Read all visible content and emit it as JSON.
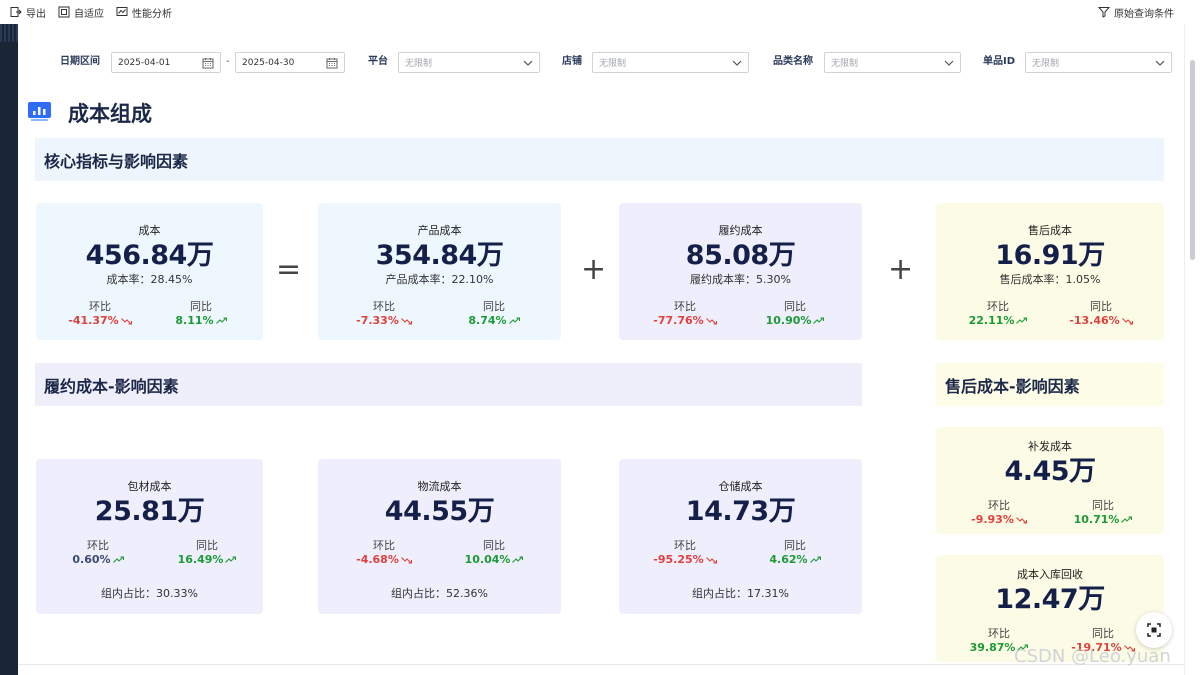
{
  "toolbar": {
    "export_label": "导出",
    "fit_label": "自适应",
    "perf_label": "性能分析",
    "query_label": "原始查询条件"
  },
  "filters": {
    "date_label": "日期区间",
    "date_start": "2025-04-01",
    "date_sep": "-",
    "date_end": "2025-04-30",
    "platform_label": "平台",
    "store_label": "店铺",
    "category_label": "品类名称",
    "item_label": "单品ID",
    "unlimited": "无限制"
  },
  "page_title": "成本组成",
  "sections": {
    "core": "核心指标与影响因素",
    "fulfill": "履约成本-影响因素",
    "aftersale": "售后成本-影响因素"
  },
  "operators": {
    "equals": "=",
    "plus": "+"
  },
  "core_cards": [
    {
      "label": "成本",
      "value": "456.84万",
      "rate": "成本率：28.45%",
      "mom_label": "环比",
      "mom": "-41.37%",
      "mom_dir": "down",
      "yoy_label": "同比",
      "yoy": "8.11%",
      "yoy_dir": "up"
    },
    {
      "label": "产品成本",
      "value": "354.84万",
      "rate": "产品成本率：22.10%",
      "mom_label": "环比",
      "mom": "-7.33%",
      "mom_dir": "down",
      "yoy_label": "同比",
      "yoy": "8.74%",
      "yoy_dir": "up"
    },
    {
      "label": "履约成本",
      "value": "85.08万",
      "rate": "履约成本率：5.30%",
      "mom_label": "环比",
      "mom": "-77.76%",
      "mom_dir": "down",
      "yoy_label": "同比",
      "yoy": "10.90%",
      "yoy_dir": "up"
    },
    {
      "label": "售后成本",
      "value": "16.91万",
      "rate": "售后成本率：1.05%",
      "mom_label": "环比",
      "mom": "22.11%",
      "mom_dir": "up",
      "yoy_label": "同比",
      "yoy": "-13.46%",
      "yoy_dir": "down"
    }
  ],
  "fulfill_cards": [
    {
      "label": "包材成本",
      "value": "25.81万",
      "mom_label": "环比",
      "mom": "0.60%",
      "mom_dir": "up",
      "yoy_label": "同比",
      "yoy": "16.49%",
      "yoy_dir": "up",
      "share": "组内占比：30.33%"
    },
    {
      "label": "物流成本",
      "value": "44.55万",
      "mom_label": "环比",
      "mom": "-4.68%",
      "mom_dir": "down",
      "yoy_label": "同比",
      "yoy": "10.04%",
      "yoy_dir": "up",
      "share": "组内占比：52.36%"
    },
    {
      "label": "仓储成本",
      "value": "14.73万",
      "mom_label": "环比",
      "mom": "-95.25%",
      "mom_dir": "down",
      "yoy_label": "同比",
      "yoy": "4.62%",
      "yoy_dir": "up",
      "share": "组内占比：17.31%"
    }
  ],
  "aftersale_cards": [
    {
      "label": "补发成本",
      "value": "4.45万",
      "mom_label": "环比",
      "mom": "-9.93%",
      "mom_dir": "down",
      "yoy_label": "同比",
      "yoy": "10.71%",
      "yoy_dir": "up"
    },
    {
      "label": "成本入库回收",
      "value": "12.47万",
      "mom_label": "环比",
      "mom": "39.87%",
      "mom_dir": "up",
      "yoy_label": "同比",
      "yoy": "-19.71%",
      "yoy_dir": "down"
    }
  ],
  "colors": {
    "up": "#1d9a36",
    "down": "#e0413c",
    "accent": "#2f6df6"
  },
  "watermark": "CSDN @Leo.yuan"
}
